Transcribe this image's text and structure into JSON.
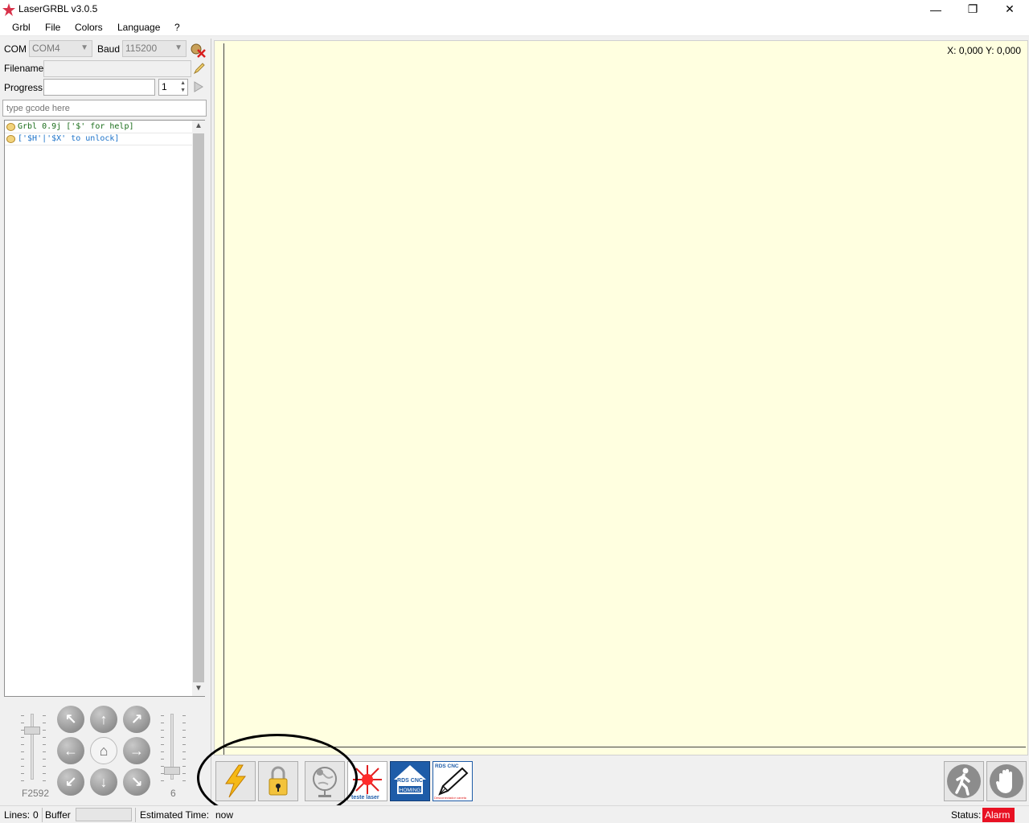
{
  "window": {
    "title": "LaserGRBL v3.0.5",
    "minimize": "—",
    "restore": "❐",
    "close": "✕"
  },
  "menu": [
    "Grbl",
    "File",
    "Colors",
    "Language",
    "?"
  ],
  "connection": {
    "com_label": "COM",
    "com_value": "COM4",
    "baud_label": "Baud",
    "baud_value": "115200"
  },
  "file": {
    "filename_label": "Filename",
    "progress_label": "Progress",
    "copies_value": "1"
  },
  "gcode": {
    "placeholder": "type gcode here"
  },
  "console": {
    "lines": [
      {
        "text": "Grbl 0.9j ['$' for help]",
        "color": "#1a6d1a"
      },
      {
        "text": "['$H'|'$X' to unlock]",
        "color": "#1d73c9"
      }
    ]
  },
  "jog": {
    "speed_label": "F2592",
    "step_label": "6",
    "speed_level": 0.75,
    "step_level": 0.1,
    "buttons": {
      "up_left": "↖",
      "up": "↑",
      "up_right": "↗",
      "left": "←",
      "home": "⌂",
      "right": "→",
      "down_left": "↙",
      "down": "↓",
      "down_right": "↘"
    }
  },
  "canvas": {
    "coords": "X: 0,000 Y: 0,000"
  },
  "toolbar": {
    "custom1_caption": "teste laser",
    "custom2_top": "RDS CNC",
    "custom2_bottom": "HOMING",
    "custom3_top": "RDS CNC",
    "custom3_bottom": "Desconectador caneta"
  },
  "status": {
    "lines_label": "Lines:",
    "lines_value": "0",
    "buffer_label": "Buffer",
    "time_label": "Estimated Time:",
    "time_value": "now",
    "status_label": "Status:",
    "status_value": "Alarm"
  },
  "colors": {
    "canvas_bg": "#ffffe0",
    "alarm": "#e81123",
    "accent_blue": "#1e5ca8"
  }
}
